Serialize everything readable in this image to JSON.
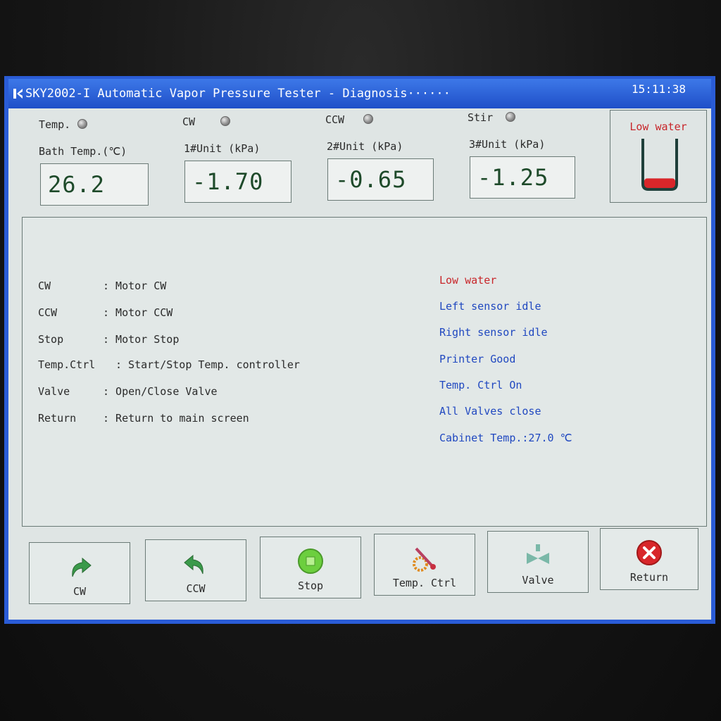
{
  "window": {
    "title": "SKY2002-I Automatic Vapor Pressure Tester - Diagnosis······",
    "clock": "15:11:38"
  },
  "indicators": [
    {
      "label": "Temp."
    },
    {
      "label": "CW"
    },
    {
      "label": "CCW"
    },
    {
      "label": "Stir"
    }
  ],
  "readouts": [
    {
      "label": "Bath Temp.(℃)",
      "value": "26.2"
    },
    {
      "label": "1#Unit (kPa)",
      "value": "-1.70"
    },
    {
      "label": "2#Unit (kPa)",
      "value": "-0.65"
    },
    {
      "label": "3#Unit (kPa)",
      "value": "-1.25"
    }
  ],
  "water_level": {
    "label": "Low water",
    "level": 0.2,
    "color": "#d8262a"
  },
  "help": [
    {
      "key": "CW",
      "desc": ": Motor CW"
    },
    {
      "key": "CCW",
      "desc": ": Motor CCW"
    },
    {
      "key": "Stop",
      "desc": ": Motor Stop"
    },
    {
      "key": "Temp.Ctrl",
      "desc": ": Start/Stop Temp. controller"
    },
    {
      "key": "Valve",
      "desc": ": Open/Close Valve"
    },
    {
      "key": "Return",
      "desc": ": Return to main screen"
    }
  ],
  "status": [
    {
      "text": "Low water",
      "level": "warn"
    },
    {
      "text": "Left sensor idle",
      "level": "info"
    },
    {
      "text": "Right sensor idle",
      "level": "info"
    },
    {
      "text": "Printer Good",
      "level": "info"
    },
    {
      "text": "Temp. Ctrl On",
      "level": "info"
    },
    {
      "text": "All Valves close",
      "level": "info"
    },
    {
      "text": "Cabinet Temp.:27.0 ℃",
      "level": "info"
    }
  ],
  "buttons": [
    {
      "label": "CW",
      "icon": "rotate-cw-arrow-icon"
    },
    {
      "label": "CCW",
      "icon": "rotate-ccw-arrow-icon"
    },
    {
      "label": "Stop",
      "icon": "stop-circle-icon"
    },
    {
      "label": "Temp. Ctrl",
      "icon": "thermometer-icon"
    },
    {
      "label": "Valve",
      "icon": "valve-icon"
    },
    {
      "label": "Return",
      "icon": "close-x-icon"
    }
  ],
  "colors": {
    "titlebar": "#2a5cd6",
    "warning": "#c8262a",
    "status_text": "#2048c0",
    "readout_digits": "#1e4a2a"
  }
}
